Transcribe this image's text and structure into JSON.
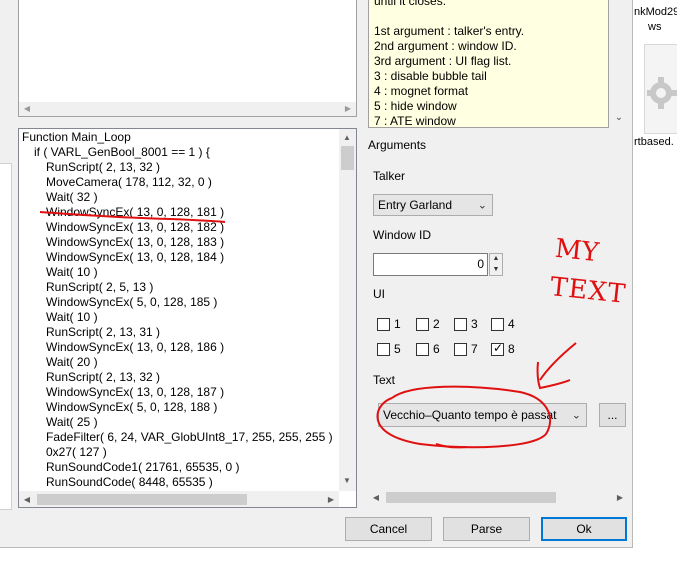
{
  "desktop": {
    "label_top": "nkMod29",
    "label_second": "ws",
    "label_bottom": "rtbased."
  },
  "code": {
    "lines": [
      "Function Main_Loop",
      "if ( VARL_GenBool_8001 == 1 ) {",
      "RunScript( 2, 13, 32 )",
      "MoveCamera( 178, 112, 32, 0 )",
      "Wait( 32 )",
      "WindowSyncEx( 13, 0, 128, 181 )",
      "WindowSyncEx( 13, 0, 128, 182 )",
      "WindowSyncEx( 13, 0, 128, 183 )",
      "WindowSyncEx( 13, 0, 128, 184 )",
      "Wait( 10 )",
      "RunScript( 2, 5, 13 )",
      "WindowSyncEx( 5, 0, 128, 185 )",
      "Wait( 10 )",
      "RunScript( 2, 13, 31 )",
      "WindowSyncEx( 13, 0, 128, 186 )",
      "Wait( 20 )",
      "RunScript( 2, 13, 32 )",
      "WindowSyncEx( 13, 0, 128, 187 )",
      "WindowSyncEx( 5, 0, 128, 188 )",
      "Wait( 25 )",
      "FadeFilter( 6, 24, VAR_GlobUInt8_17, 255, 255, 255 )",
      "0x27( 127 )",
      "RunSoundCode1( 21761, 65535, 0 )",
      "RunSoundCode( 8448, 65535 )"
    ]
  },
  "help": {
    "lines": [
      "until it closes.",
      "",
      "1st argument : talker's entry.",
      "2nd argument : window ID.",
      "3rd argument : UI flag list.",
      " 3 : disable bubble tail",
      " 4 : mognet format",
      " 5 : hide window",
      " 7 : ATE window"
    ]
  },
  "arguments": {
    "title": "Arguments",
    "talker_label": "Talker",
    "talker_value": "Entry Garland",
    "window_id_label": "Window ID",
    "window_id_value": "0",
    "ui_label": "UI",
    "ui_flags": [
      {
        "label": "1",
        "checked": false
      },
      {
        "label": "2",
        "checked": false
      },
      {
        "label": "3",
        "checked": false
      },
      {
        "label": "4",
        "checked": false
      },
      {
        "label": "5",
        "checked": false
      },
      {
        "label": "6",
        "checked": false
      },
      {
        "label": "7",
        "checked": false
      },
      {
        "label": "8",
        "checked": true
      }
    ],
    "text_label": "Text",
    "text_value": "Vecchio–Quanto tempo è passat",
    "browse_label": "..."
  },
  "buttons": {
    "cancel": "Cancel",
    "parse": "Parse",
    "ok": "Ok"
  },
  "annotation": {
    "text_line1": "MY",
    "text_line2": "TEXT",
    "color": "#e01010"
  },
  "colors": {
    "help_bg": "#ffffe1",
    "default_button_border": "#0078d7"
  }
}
